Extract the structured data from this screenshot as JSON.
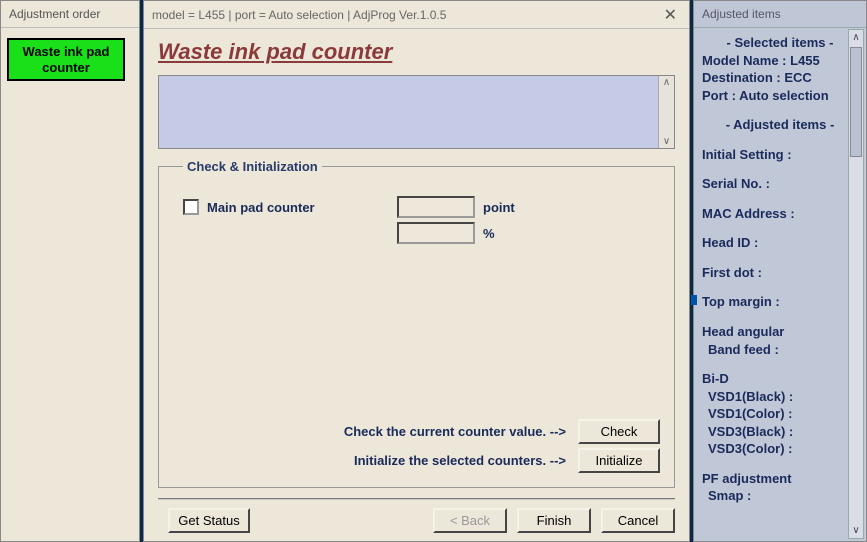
{
  "left": {
    "header": "Adjustment order",
    "button": "Waste ink pad counter"
  },
  "center": {
    "titlebar": "model = L455 | port = Auto selection | AdjProg Ver.1.0.5",
    "page_title": "Waste ink pad counter",
    "group_title": "Check & Initialization",
    "main_pad_label": "Main pad counter",
    "point_unit": "point",
    "percent_unit": "%",
    "check_text": "Check the current counter value. -->",
    "init_text": "Initialize the selected counters. -->",
    "check_btn": "Check",
    "init_btn": "Initialize",
    "get_status": "Get Status",
    "back": "< Back",
    "finish": "Finish",
    "cancel": "Cancel"
  },
  "right": {
    "header": "Adjusted items",
    "selected_hdr": "- Selected items -",
    "model_name": "Model Name : L455",
    "destination": "Destination : ECC",
    "port": "Port : Auto selection",
    "adjusted_hdr": "- Adjusted items -",
    "initial_setting": "Initial Setting :",
    "serial_no": "Serial No. :",
    "mac_address": "MAC Address :",
    "head_id": "Head ID :",
    "first_dot": "First dot :",
    "top_margin": "Top margin :",
    "head_angular": "Head angular",
    "band_feed": "Band feed :",
    "bi_d": "Bi-D",
    "vsd1_black": "VSD1(Black) :",
    "vsd1_color": "VSD1(Color) :",
    "vsd3_black": "VSD3(Black) :",
    "vsd3_color": "VSD3(Color) :",
    "pf_adjustment": "PF adjustment",
    "smap": "Smap :"
  }
}
